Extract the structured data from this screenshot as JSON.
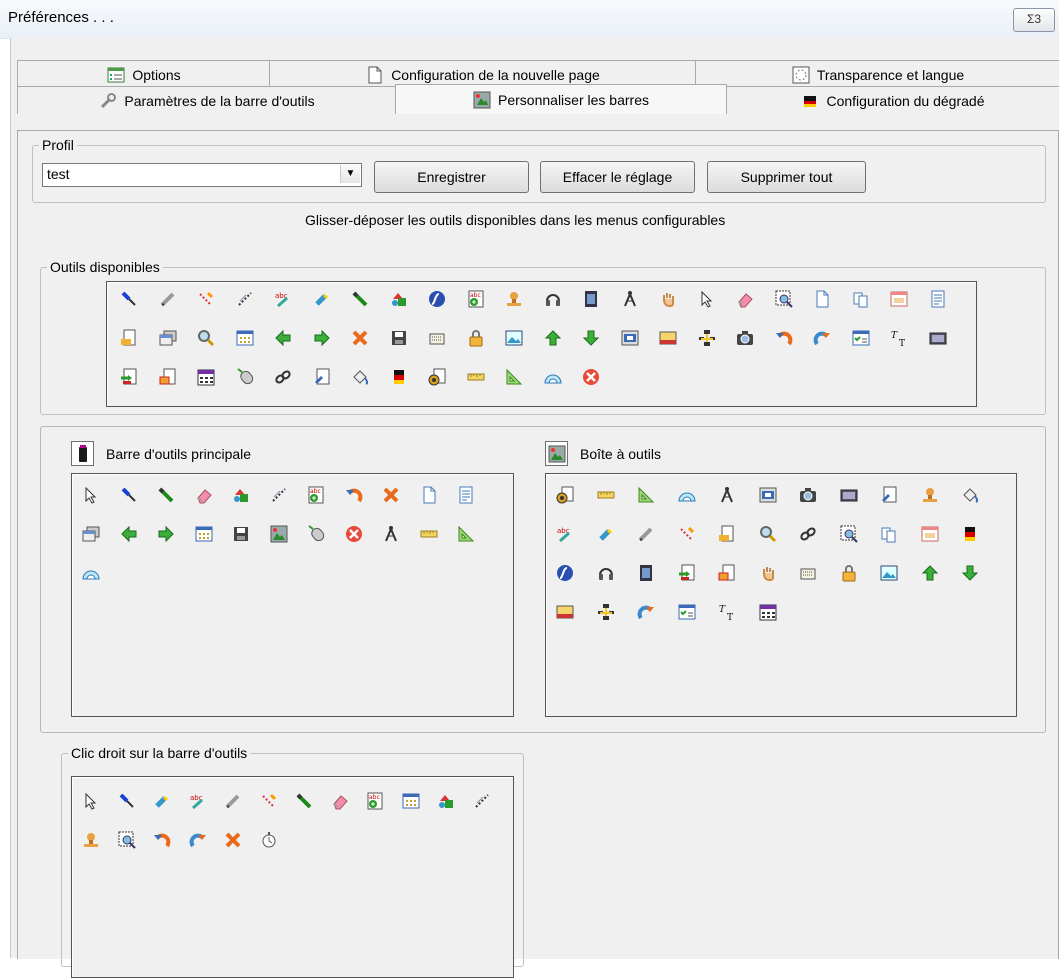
{
  "window": {
    "title": "Préférences . . .",
    "close_glyph": "Σ3"
  },
  "tabs": {
    "row1": [
      {
        "label": "Options",
        "icon": "options-icon"
      },
      {
        "label": "Configuration de la nouvelle page",
        "icon": "new-page-icon"
      },
      {
        "label": "Transparence et langue",
        "icon": "transparency-icon"
      }
    ],
    "row2": [
      {
        "label": "Paramètres de la barre d'outils",
        "icon": "wrench-icon"
      },
      {
        "label": "Personnaliser les barres",
        "icon": "customize-bars-icon",
        "active": true
      },
      {
        "label": "Configuration du dégradé",
        "icon": "gradient-icon"
      }
    ]
  },
  "profile": {
    "legend": "Profil",
    "selected": "test",
    "save_label": "Enregistrer",
    "clear_label": "Effacer le réglage",
    "delete_all_label": "Supprimer tout"
  },
  "instruction": "Glisser-déposer les outils disponibles dans les menus configurables",
  "available_tools": {
    "legend": "Outils disponibles",
    "icons": [
      "blue-pen",
      "pencil",
      "red-dotted-pen",
      "dotted-line",
      "spellcheck-pen",
      "highlighter",
      "green-marker",
      "shapes",
      "flash",
      "spellcheck-add",
      "stamp",
      "headphones",
      "film",
      "compass",
      "hand",
      "cursor",
      "eraser",
      "zoom-select",
      "page",
      "copy-page",
      "calendar-window",
      "document",
      "page-export",
      "windows",
      "magnifier",
      "grid",
      "arrow-left",
      "arrow-right",
      "close-x",
      "save",
      "keyboard",
      "lock",
      "image",
      "arrow-up",
      "arrow-down",
      "projector",
      "slide",
      "network",
      "camera",
      "undo",
      "redo",
      "checklist",
      "text-tool",
      "film-clip",
      "import",
      "color-export",
      "calendar",
      "mouse",
      "chain-link",
      "paint-doc",
      "paint-bucket",
      "gradient",
      "speaker-doc",
      "ruler",
      "set-square",
      "protractor",
      "stop"
    ]
  },
  "main_toolbar": {
    "label": "Barre d'outils principale",
    "icons": [
      "cursor",
      "blue-pen",
      "green-marker",
      "eraser",
      "shapes",
      "dotted-line",
      "spellcheck-add",
      "undo",
      "close-x",
      "page",
      "document",
      "windows",
      "arrow-left",
      "arrow-right",
      "grid",
      "save",
      "customize-bars",
      "mouse",
      "stop",
      "compass",
      "ruler",
      "set-square",
      "protractor"
    ]
  },
  "toolbox": {
    "label": "Boîte à outils",
    "icons": [
      "speaker-doc",
      "ruler",
      "set-square",
      "protractor",
      "compass",
      "projector",
      "camera",
      "film-clip",
      "paint-doc",
      "stamp",
      "paint-bucket",
      "spellcheck-pen",
      "highlighter",
      "pencil",
      "red-dotted-pen",
      "page-export",
      "magnifier",
      "chain-link",
      "zoom-select",
      "copy-page",
      "calendar-window",
      "gradient",
      "flash",
      "headphones",
      "film",
      "import",
      "color-export",
      "hand",
      "keyboard",
      "lock",
      "image",
      "arrow-up",
      "arrow-down",
      "slide",
      "network",
      "redo",
      "checklist",
      "text-tool",
      "calendar"
    ]
  },
  "right_click_toolbar": {
    "legend": "Clic droit sur la barre d'outils",
    "icons": [
      "cursor",
      "blue-pen",
      "highlighter",
      "spellcheck-pen",
      "pencil",
      "red-dotted-pen",
      "green-marker",
      "eraser",
      "spellcheck-add",
      "grid",
      "shapes",
      "dotted-line",
      "stamp",
      "zoom-select",
      "undo",
      "redo",
      "close-x",
      "stopwatch"
    ]
  }
}
